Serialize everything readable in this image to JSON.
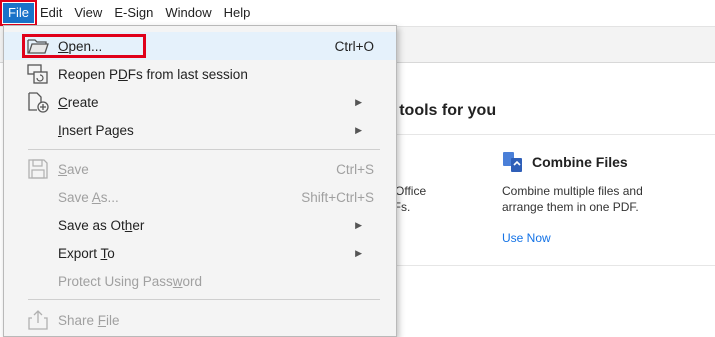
{
  "menubar": {
    "file": "File",
    "edit": "Edit",
    "view": "View",
    "esign": "E-Sign",
    "window": "Window",
    "help": "Help"
  },
  "background": {
    "tools_heading": "d tools for you",
    "left_desc_1": "ft Office",
    "left_desc_2": "DFs.",
    "combine_title": "Combine Files",
    "combine_desc_1": "Combine multiple files and",
    "combine_desc_2": "arrange them in one PDF.",
    "use_now": "Use Now"
  },
  "file_menu": {
    "open": {
      "pre": "",
      "u": "O",
      "post": "pen...",
      "shortcut": "Ctrl+O"
    },
    "reopen": {
      "pre": "Reopen P",
      "u": "D",
      "post": "Fs from last session"
    },
    "create": {
      "pre": "",
      "u": "C",
      "post": "reate"
    },
    "insert_pages": {
      "pre": "",
      "u": "I",
      "post": "nsert Pages"
    },
    "save": {
      "pre": "",
      "u": "S",
      "post": "ave",
      "shortcut": "Ctrl+S"
    },
    "save_as": {
      "pre": "Save ",
      "u": "A",
      "post": "s...",
      "shortcut": "Shift+Ctrl+S"
    },
    "save_as_other": {
      "pre": "Save as Ot",
      "u": "h",
      "post": "er"
    },
    "export_to": {
      "pre": "Export ",
      "u": "T",
      "post": "o"
    },
    "protect": {
      "pre": "Protect Using Pass",
      "u": "w",
      "post": "ord"
    },
    "share": {
      "pre": "Share ",
      "u": "F",
      "post": "ile"
    }
  },
  "icons": {
    "open": "folder-open-icon",
    "reopen": "reopen-files-icon",
    "create": "create-file-icon",
    "save": "save-disk-icon",
    "share": "share-upload-icon",
    "submenu": "chevron-right-icon"
  },
  "colors": {
    "file_menu_bg": "#1a73c9",
    "highlight_border": "#e0001a",
    "menu_bg": "#f4f4f4",
    "hover_row": "#e5f1fb",
    "link": "#1473e6"
  }
}
